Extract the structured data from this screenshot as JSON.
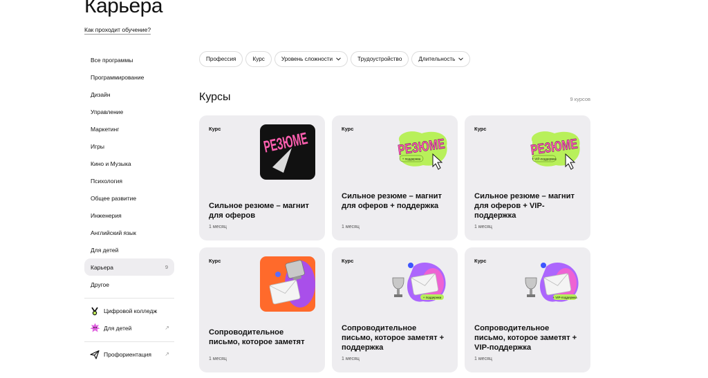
{
  "header": {
    "title": "Карьера",
    "how_link": "Как проходит обучение?"
  },
  "sidebar": {
    "items": [
      {
        "label": "Все программы"
      },
      {
        "label": "Программирование"
      },
      {
        "label": "Дизайн"
      },
      {
        "label": "Управление"
      },
      {
        "label": "Маркетинг"
      },
      {
        "label": "Игры"
      },
      {
        "label": "Кино и Музыка"
      },
      {
        "label": "Психология"
      },
      {
        "label": "Общее развитие"
      },
      {
        "label": "Инженерия"
      },
      {
        "label": "Английский язык"
      },
      {
        "label": "Для детей"
      },
      {
        "label": "Карьера",
        "count": "9",
        "active": true
      },
      {
        "label": "Другое"
      }
    ],
    "extras": [
      {
        "label": "Цифровой колледж",
        "icon": "college-logo-icon"
      },
      {
        "label": "Для детей",
        "icon": "kids-star-icon",
        "arrow": "↗"
      }
    ],
    "extras2": [
      {
        "label": "Профориентация",
        "icon": "paper-plane-icon",
        "arrow": "↗"
      }
    ]
  },
  "filters": [
    {
      "label": "Профессия"
    },
    {
      "label": "Курс"
    },
    {
      "label": "Уровень сложности",
      "dropdown": true
    },
    {
      "label": "Трудоустройство"
    },
    {
      "label": "Длительность",
      "dropdown": true
    }
  ],
  "main": {
    "section_title": "Курсы",
    "count_label": "9 курсов",
    "cards": [
      {
        "type": "Курс",
        "title": "Сильное резюме – магнит для оферов",
        "duration": "1 месяц",
        "art": "resume-dark",
        "art_text": "РЕЗЮМЕ"
      },
      {
        "type": "Курс",
        "title": "Сильное резюме – магнит для оферов + поддержка",
        "duration": "1 месяц",
        "art": "resume-blob",
        "art_text": "РЕЗЮМЕ",
        "tag": "+ поддержка"
      },
      {
        "type": "Курс",
        "title": "Сильное резюме – магнит для оферов + VIP-поддержка",
        "duration": "1 месяц",
        "art": "resume-blob",
        "art_text": "РЕЗЮМЕ",
        "tag": "+ VIP-поддержка"
      },
      {
        "type": "Курс",
        "title": "Сопроводительное письмо, которое заметят",
        "duration": "1 месяц",
        "art": "letter-orange"
      },
      {
        "type": "Курс",
        "title": "Сопроводительное письмо, которое заметят + поддержка",
        "duration": "1 месяц",
        "art": "letter-blob",
        "tag": "+ поддержка"
      },
      {
        "type": "Курс",
        "title": "Сопроводительное письмо, которое заметят + VIP-поддержка",
        "duration": "1 месяц",
        "art": "letter-blob",
        "tag": "+ VIP-поддержка"
      }
    ]
  },
  "colors": {
    "card_bg": "#eeedf0",
    "pink": "#ff5fb0",
    "lime": "#b8f05a",
    "orange": "#ff6a2b",
    "purple": "#a04dff"
  }
}
